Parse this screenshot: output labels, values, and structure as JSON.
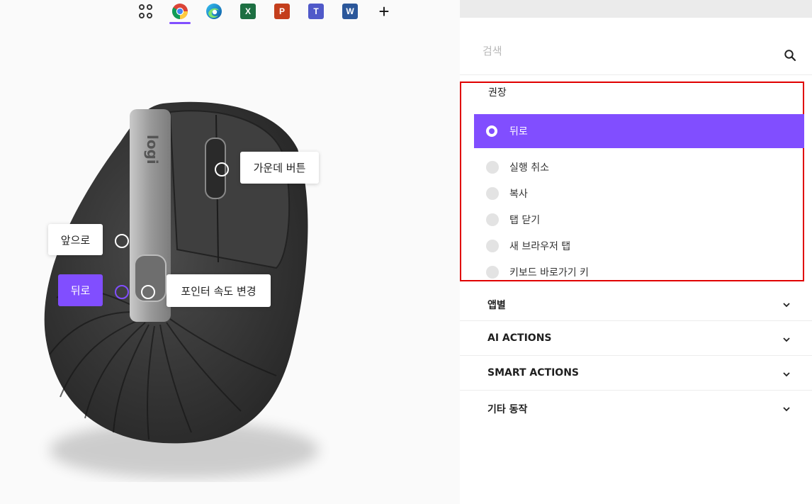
{
  "app_bar": {
    "apps": [
      {
        "icon": "all-apps-icon"
      },
      {
        "icon": "chrome-icon",
        "active": true
      },
      {
        "icon": "edge-icon"
      },
      {
        "icon": "excel-icon",
        "letter": "X",
        "color": "#1d6f42"
      },
      {
        "icon": "powerpoint-icon",
        "letter": "P",
        "color": "#c43e1c"
      },
      {
        "icon": "teams-icon",
        "letter": "T",
        "color": "#5059c9"
      },
      {
        "icon": "word-icon",
        "letter": "W",
        "color": "#2b579a"
      },
      {
        "icon": "plus-icon",
        "symbol": "+"
      }
    ]
  },
  "mouse": {
    "logo": "logi",
    "callouts": {
      "middle": "가운데 버튼",
      "forward": "앞으로",
      "back": "뒤로",
      "pointer_speed": "포인터 속도 변경"
    },
    "selected_callout": "back"
  },
  "panel": {
    "search": {
      "placeholder": "검색"
    },
    "recommended": {
      "title": "권장",
      "items": [
        {
          "label": "뒤로",
          "selected": true
        },
        {
          "label": "실행 취소"
        },
        {
          "label": "복사"
        },
        {
          "label": "탭 닫기"
        },
        {
          "label": "새 브라우저 탭"
        },
        {
          "label": "키보드 바로가기 키"
        }
      ]
    },
    "sections": [
      {
        "label": "앱별"
      },
      {
        "label": "AI ACTIONS"
      },
      {
        "label": "SMART ACTIONS"
      },
      {
        "label": "기타 동작"
      }
    ]
  },
  "colors": {
    "accent": "#814eff",
    "highlight_border": "#e00000",
    "panel_top": "#ebebeb"
  }
}
